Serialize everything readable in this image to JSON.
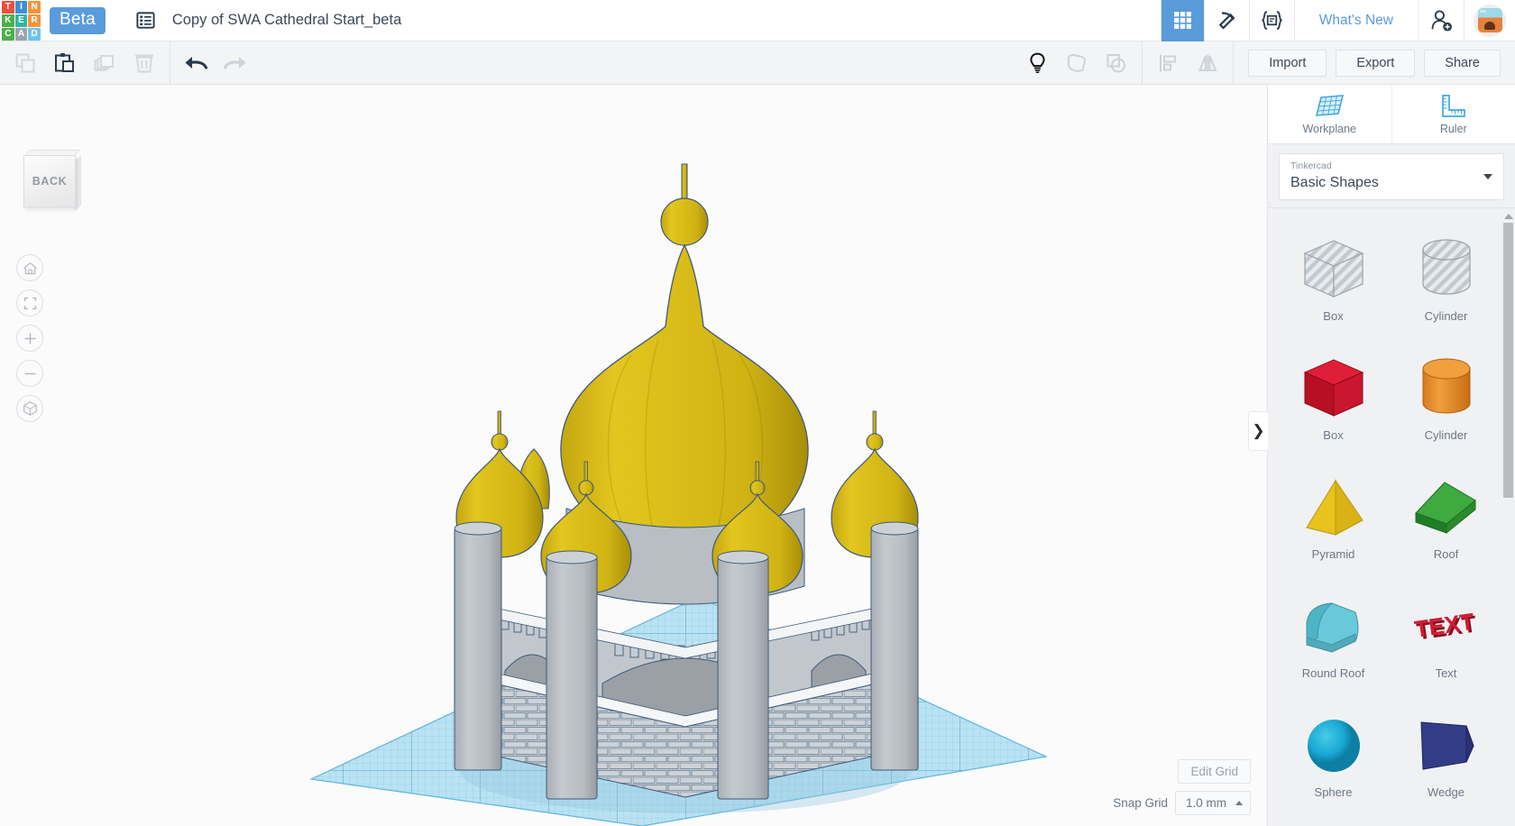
{
  "topbar": {
    "logo_tiles": [
      {
        "letter": "T",
        "color": "#ee4d3d"
      },
      {
        "letter": "I",
        "color": "#3d8fd6"
      },
      {
        "letter": "N",
        "color": "#f2943b"
      },
      {
        "letter": "K",
        "color": "#4cae4c"
      },
      {
        "letter": "E",
        "color": "#2eb8a0"
      },
      {
        "letter": "R",
        "color": "#f2943b"
      },
      {
        "letter": "C",
        "color": "#4cae4c"
      },
      {
        "letter": "A",
        "color": "#9aa3ab"
      },
      {
        "letter": "D",
        "color": "#6fc3ea"
      }
    ],
    "beta_label": "Beta",
    "project_list_icon": "list-icon",
    "document_title": "Copy of SWA Cathedral Start_beta",
    "grid_view_icon": "grid-apps-icon",
    "codeblocks_icon": "pickaxe-icon",
    "blocks_icon": "code-brackets-icon",
    "whats_new_label": "What's New",
    "invite_icon": "person-add-icon",
    "avatar_icon": "user-avatar",
    "accent_color": "#5a9bdc"
  },
  "toolbar": {
    "copy_label": "Copy",
    "paste_label": "Paste",
    "duplicate_label": "Duplicate",
    "delete_label": "Delete",
    "undo_label": "Undo",
    "redo_label": "Redo",
    "hint_label": "Show Hints",
    "group_label": "Group",
    "ungroup_label": "Ungroup",
    "align_label": "Align",
    "mirror_label": "Mirror",
    "import_label": "Import",
    "export_label": "Export",
    "share_label": "Share"
  },
  "canvas": {
    "view_cube_label": "BACK",
    "nav": [
      {
        "name": "home-view",
        "icon": "home-icon"
      },
      {
        "name": "fit-to-view",
        "icon": "fit-frame-icon"
      },
      {
        "name": "zoom-in",
        "icon": "plus-icon"
      },
      {
        "name": "zoom-out",
        "icon": "minus-icon"
      },
      {
        "name": "ortho-toggle",
        "icon": "cube-perspective-icon"
      }
    ],
    "edit_grid_label": "Edit Grid",
    "snap_grid_label": "Snap Grid",
    "snap_grid_value": "1.0 mm",
    "workplane_color": "#aadcf0",
    "grid_line_color": "#4fa8cf",
    "model_name": "cathedral-model",
    "model_dome_color": "#d6b91a",
    "model_wall_color": "#b9bdc2"
  },
  "panel": {
    "workplane_label": "Workplane",
    "workplane_icon": "workplane-grid-icon",
    "ruler_label": "Ruler",
    "ruler_icon": "ruler-icon",
    "library_owner": "Tinkercad",
    "library_name": "Basic Shapes",
    "collapse_icon": "chevron-right-icon",
    "shapes": [
      {
        "label": "Box",
        "kind": "box",
        "color": "#c9ced4",
        "hole": true
      },
      {
        "label": "Cylinder",
        "kind": "cylinder",
        "color": "#c9ced4",
        "hole": true
      },
      {
        "label": "Box",
        "kind": "box",
        "color": "#cf1128",
        "hole": false
      },
      {
        "label": "Cylinder",
        "kind": "cylinder",
        "color": "#e8912a",
        "hole": false
      },
      {
        "label": "Pyramid",
        "kind": "pyramid",
        "color": "#e8c31e",
        "hole": false
      },
      {
        "label": "Roof",
        "kind": "roof",
        "color": "#3aa23a",
        "hole": false
      },
      {
        "label": "Round Roof",
        "kind": "roundroof",
        "color": "#5cc3d6",
        "hole": false
      },
      {
        "label": "Text",
        "kind": "text",
        "color": "#cf1128",
        "hole": false
      },
      {
        "label": "Sphere",
        "kind": "sphere",
        "color": "#17a8d4",
        "hole": false
      },
      {
        "label": "Wedge",
        "kind": "wedge",
        "color": "#2b3377",
        "hole": false
      }
    ]
  }
}
